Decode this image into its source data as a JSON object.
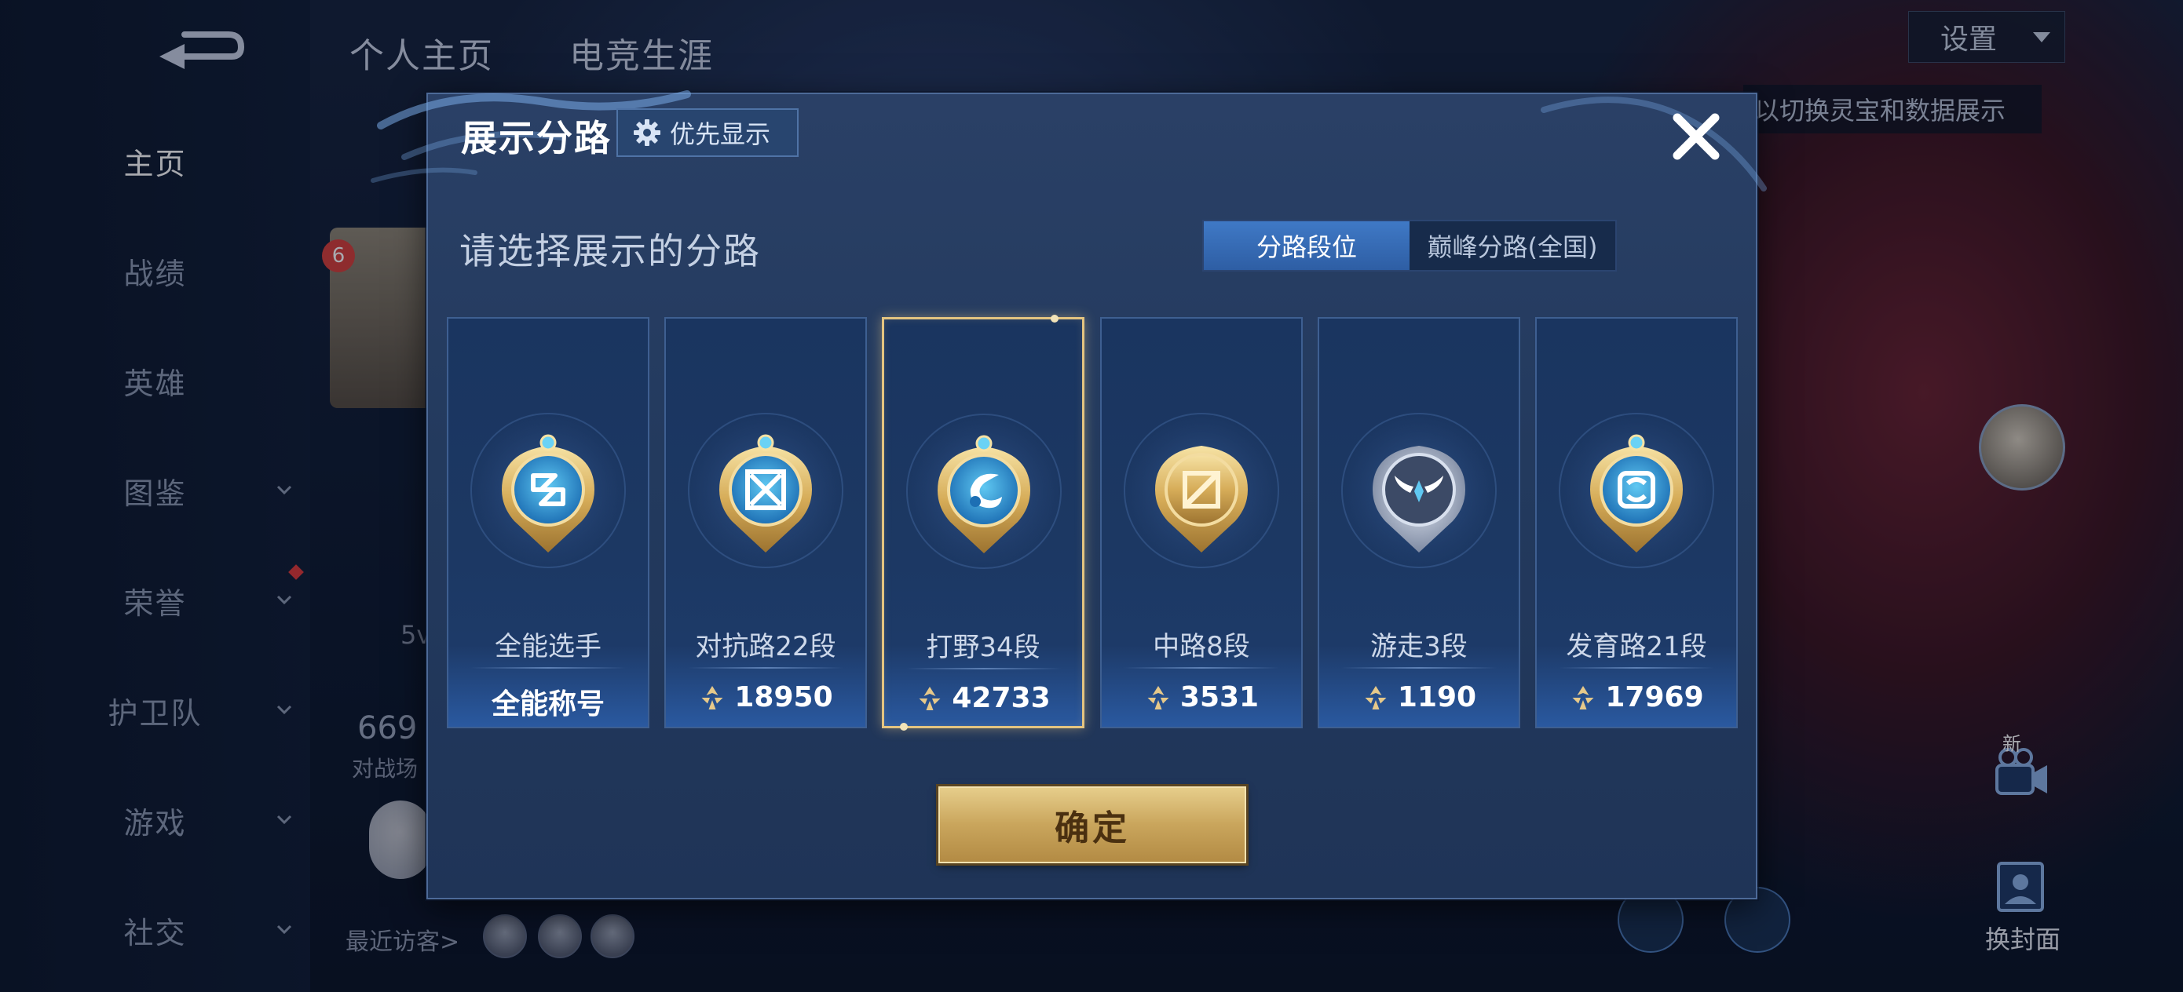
{
  "sidebar": {
    "items": [
      {
        "label": "主页",
        "active": true,
        "has_chevron": false
      },
      {
        "label": "战绩",
        "active": false,
        "has_chevron": false
      },
      {
        "label": "英雄",
        "active": false,
        "has_chevron": false
      },
      {
        "label": "图鉴",
        "active": false,
        "has_chevron": true
      },
      {
        "label": "荣誉",
        "active": false,
        "has_chevron": true
      },
      {
        "label": "护卫队",
        "active": false,
        "has_chevron": true
      },
      {
        "label": "游戏",
        "active": false,
        "has_chevron": true
      },
      {
        "label": "社交",
        "active": false,
        "has_chevron": true
      }
    ]
  },
  "header": {
    "tabs": [
      "个人主页",
      "电竞生涯"
    ],
    "settings_label": "设置",
    "hint": "以切换灵宝和数据展示"
  },
  "background": {
    "level": "6",
    "stat_number": "669",
    "stat_label": "对战场",
    "mode_text": "5v",
    "visitors_label": "最近访客>",
    "cover_label": "换封面",
    "new_tag": "新"
  },
  "modal": {
    "title": "展示分路",
    "priority_label": "优先显示",
    "subtitle": "请选择展示的分路",
    "segments": [
      {
        "label": "分路段位",
        "active": true
      },
      {
        "label": "巅峰分路(全国)",
        "active": false
      }
    ],
    "cards": [
      {
        "name": "全能选手",
        "value": "全能称号",
        "has_points_icon": false,
        "selected": false,
        "emblem": "all-round-emblem-icon"
      },
      {
        "name": "对抗路22段",
        "value": "18950",
        "has_points_icon": true,
        "selected": false,
        "emblem": "clash-lane-emblem-icon"
      },
      {
        "name": "打野34段",
        "value": "42733",
        "has_points_icon": true,
        "selected": true,
        "emblem": "jungle-emblem-icon"
      },
      {
        "name": "中路8段",
        "value": "3531",
        "has_points_icon": true,
        "selected": false,
        "emblem": "mid-lane-emblem-icon"
      },
      {
        "name": "游走3段",
        "value": "1190",
        "has_points_icon": true,
        "selected": false,
        "emblem": "roam-emblem-icon"
      },
      {
        "name": "发育路21段",
        "value": "17969",
        "has_points_icon": true,
        "selected": false,
        "emblem": "farm-lane-emblem-icon"
      }
    ],
    "confirm_label": "确定"
  },
  "colors": {
    "accent_blue": "#3f79c6",
    "gold": "#e4c480",
    "panel": "#233a5e"
  }
}
